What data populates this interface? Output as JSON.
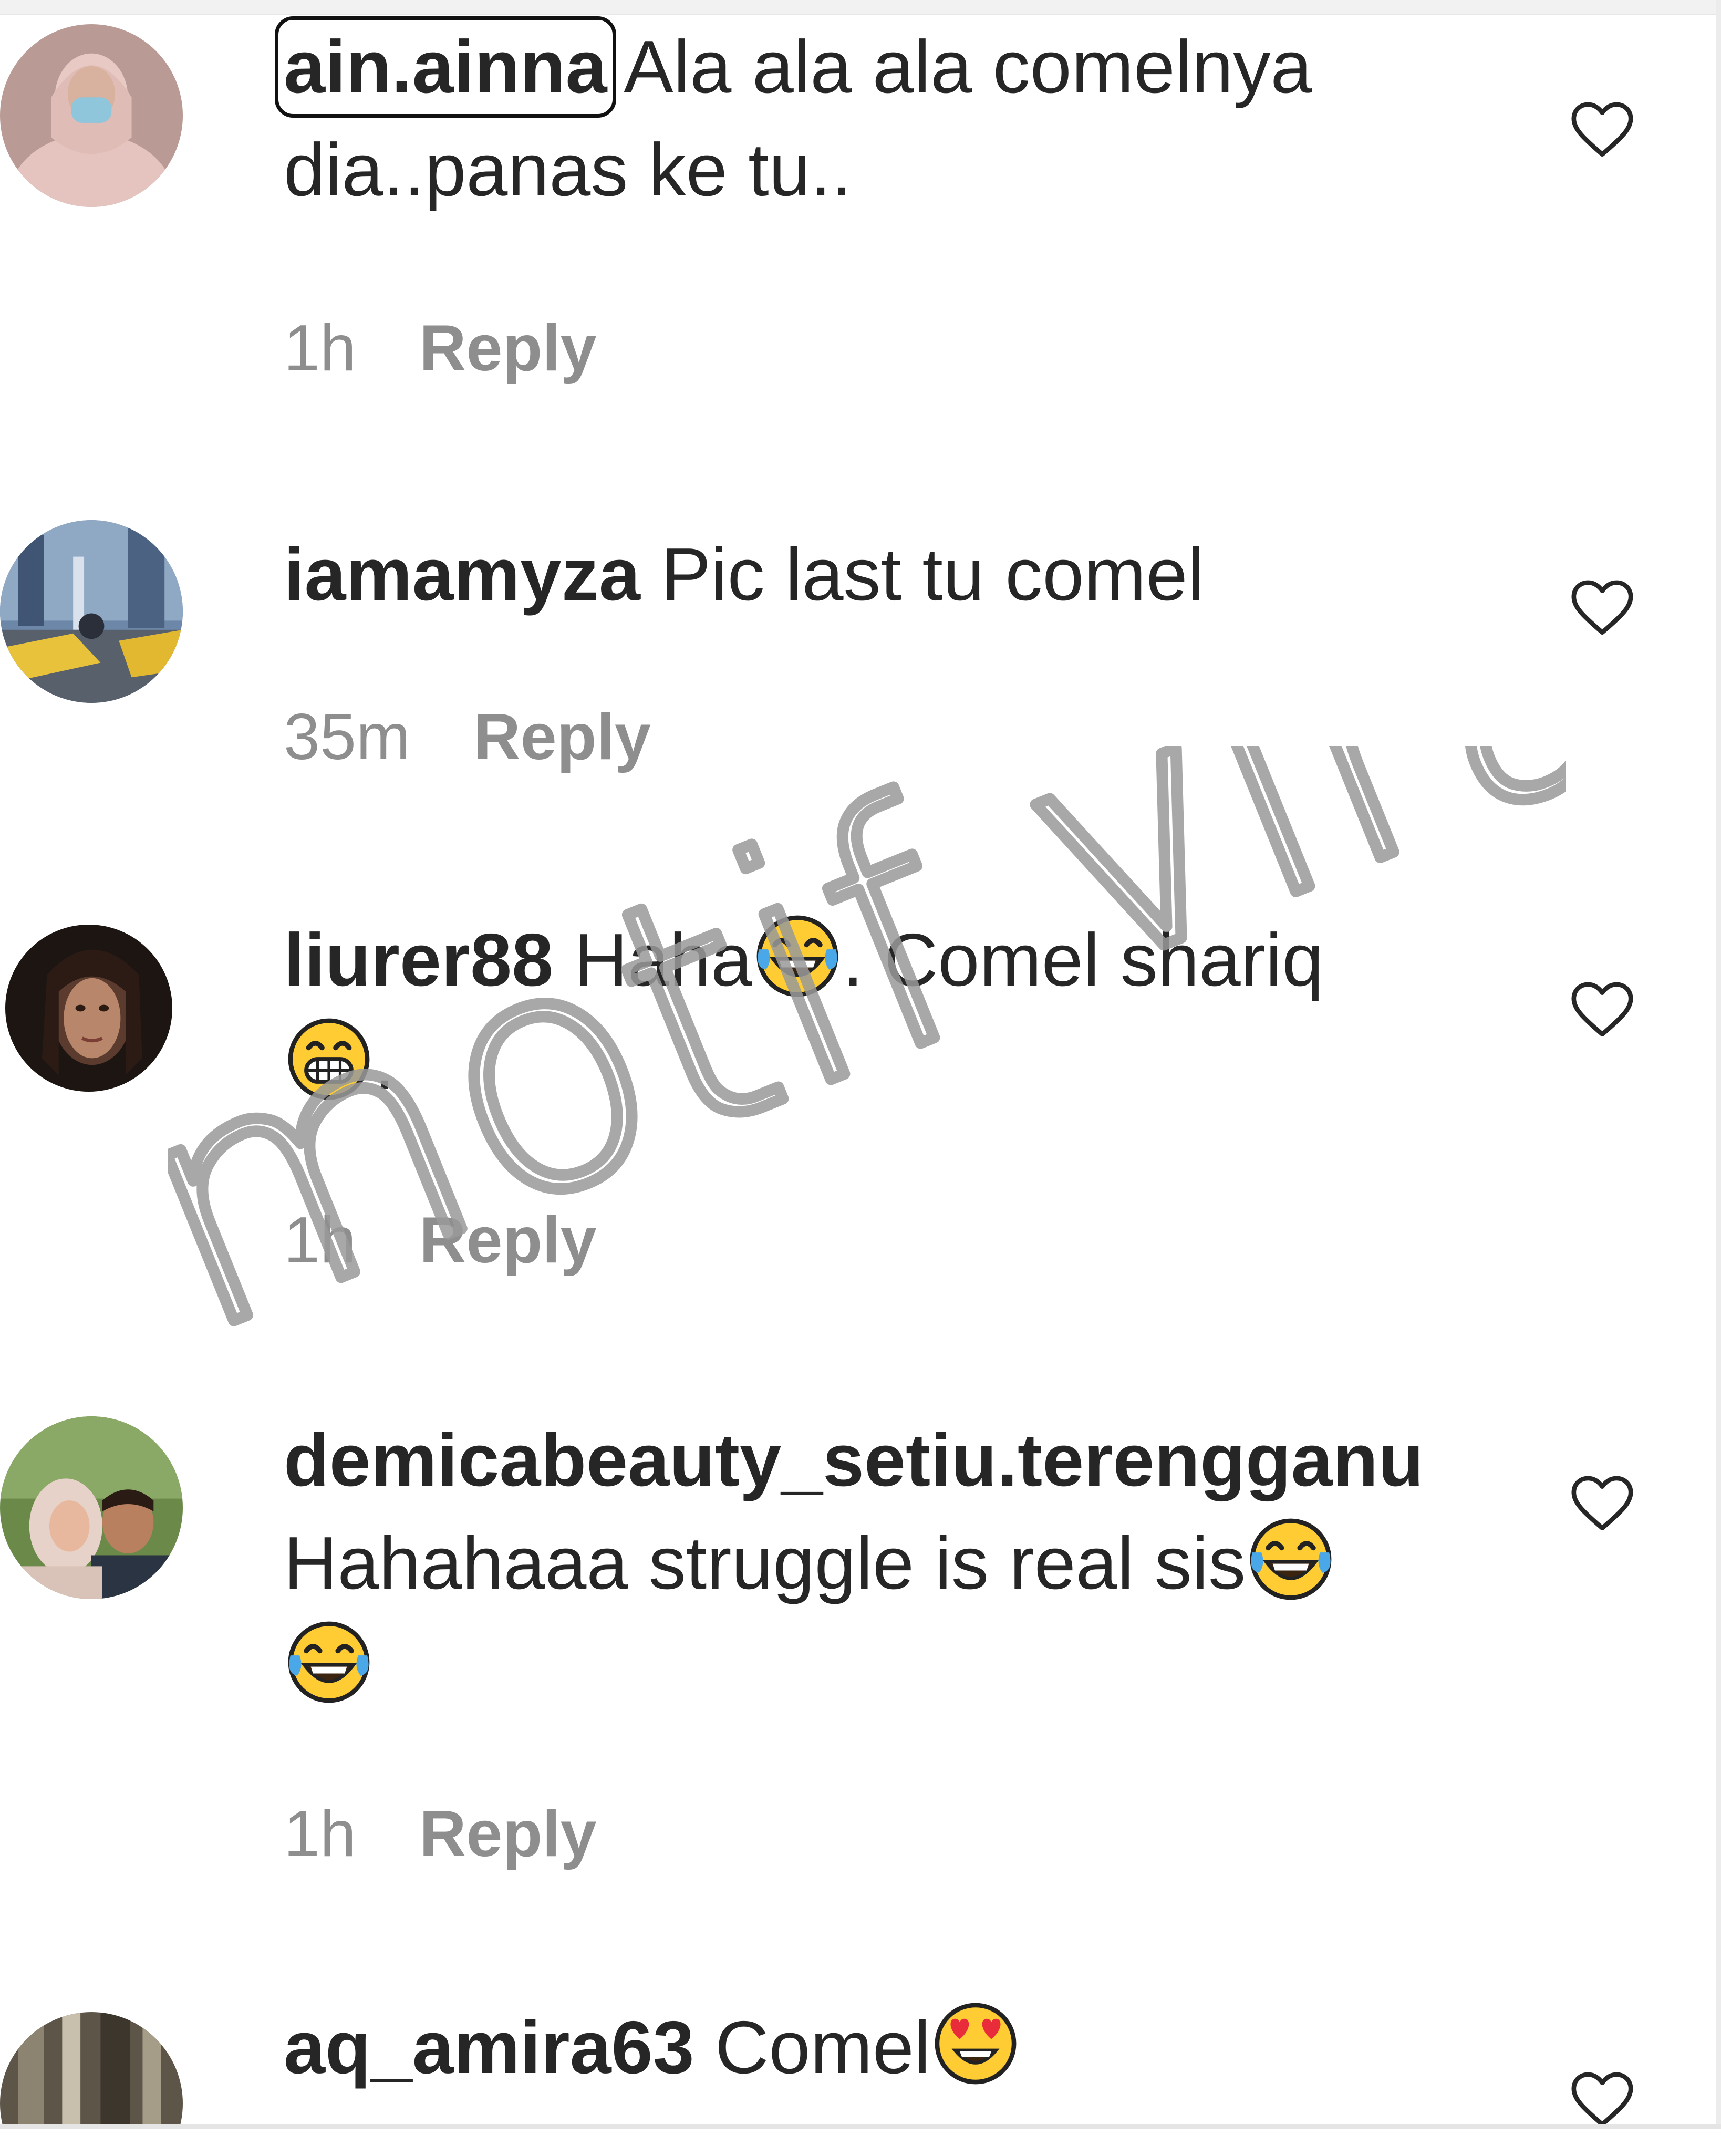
{
  "comments": [
    {
      "username": "ain.ainna",
      "text_before": " Ala ala ala comelnya dia..panas ke tu..",
      "time": "1h",
      "reply_label": "Reply",
      "avatar": "avatar-woman-mask",
      "like_icon": "heart-outline-icon"
    },
    {
      "username": "iamamyza",
      "text_before": " Pic last tu comel",
      "time": "35m",
      "reply_label": "Reply",
      "avatar": "avatar-street-photo",
      "like_icon": "heart-outline-icon"
    },
    {
      "username": "liurer88",
      "text_before": " Haha",
      "emoji_1": "tears-of-joy-emoji",
      "text_middle": ". Comel shariq",
      "emoji_2": "grinning-emoji",
      "text_after": ".",
      "time": "1h",
      "reply_label": "Reply",
      "avatar": "avatar-dark-portrait",
      "like_icon": "heart-outline-icon"
    },
    {
      "username": "demicabeauty_setiu.terengganu",
      "text_before": "Hahahaaa struggle is real sis",
      "emoji_1": "tears-of-joy-emoji",
      "emoji_2": "tears-of-joy-emoji",
      "time": "1h",
      "reply_label": "Reply",
      "avatar": "avatar-couple",
      "like_icon": "heart-outline-icon"
    },
    {
      "username": "aq_amira63",
      "text_before": " Comel",
      "emoji_1": "heart-eyes-emoji",
      "avatar": "avatar-partial",
      "like_icon": "heart-outline-icon"
    }
  ],
  "watermark": {
    "text": "motif viral"
  },
  "colors": {
    "text": "#262626",
    "meta": "#8e8e8e",
    "watermark": "#9a9a9a",
    "emoji_face": "#ffcc33"
  }
}
